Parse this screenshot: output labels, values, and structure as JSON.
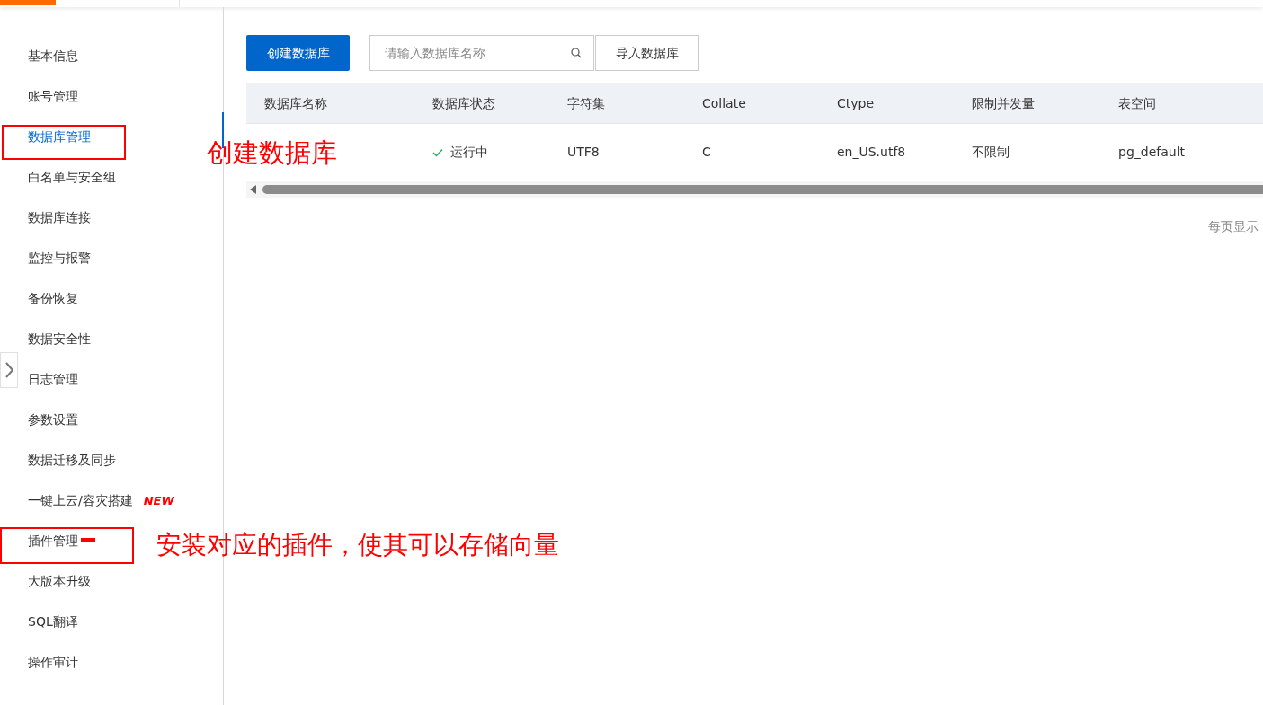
{
  "sidebar": {
    "items": [
      {
        "label": "基本信息",
        "selected": false
      },
      {
        "label": "账号管理",
        "selected": false
      },
      {
        "label": "数据库管理",
        "selected": true
      },
      {
        "label": "白名单与安全组",
        "selected": false
      },
      {
        "label": "数据库连接",
        "selected": false
      },
      {
        "label": "监控与报警",
        "selected": false
      },
      {
        "label": "备份恢复",
        "selected": false
      },
      {
        "label": "数据安全性",
        "selected": false
      },
      {
        "label": "日志管理",
        "selected": false
      },
      {
        "label": "参数设置",
        "selected": false
      },
      {
        "label": "数据迁移及同步",
        "selected": false
      },
      {
        "label": "一键上云/容灾搭建",
        "selected": false,
        "badge": "NEW"
      },
      {
        "label": "插件管理",
        "selected": false
      },
      {
        "label": "大版本升级",
        "selected": false
      },
      {
        "label": "SQL翻译",
        "selected": false
      },
      {
        "label": "操作审计",
        "selected": false
      }
    ]
  },
  "toolbar": {
    "create_button": "创建数据库",
    "search": {
      "placeholder": "请输入数据库名称"
    },
    "import_button": "导入数据库"
  },
  "table": {
    "columns": [
      "数据库名称",
      "数据库状态",
      "字符集",
      "Collate",
      "Ctype",
      "限制并发量",
      "表空间"
    ],
    "rows": [
      {
        "cells": [
          {
            "kind": "covered"
          },
          {
            "kind": "status",
            "text": "运行中"
          },
          {
            "kind": "text",
            "text": "UTF8"
          },
          {
            "kind": "text",
            "text": "C"
          },
          {
            "kind": "text",
            "text": "en_US.utf8"
          },
          {
            "kind": "text",
            "text": "不限制"
          },
          {
            "kind": "text",
            "text": "pg_default"
          }
        ]
      }
    ]
  },
  "pagination": {
    "label": "每页显示"
  },
  "annotations": [
    {
      "text": "创建数据库"
    },
    {
      "text": "安装对应的插件，使其可以存储向量"
    }
  ]
}
